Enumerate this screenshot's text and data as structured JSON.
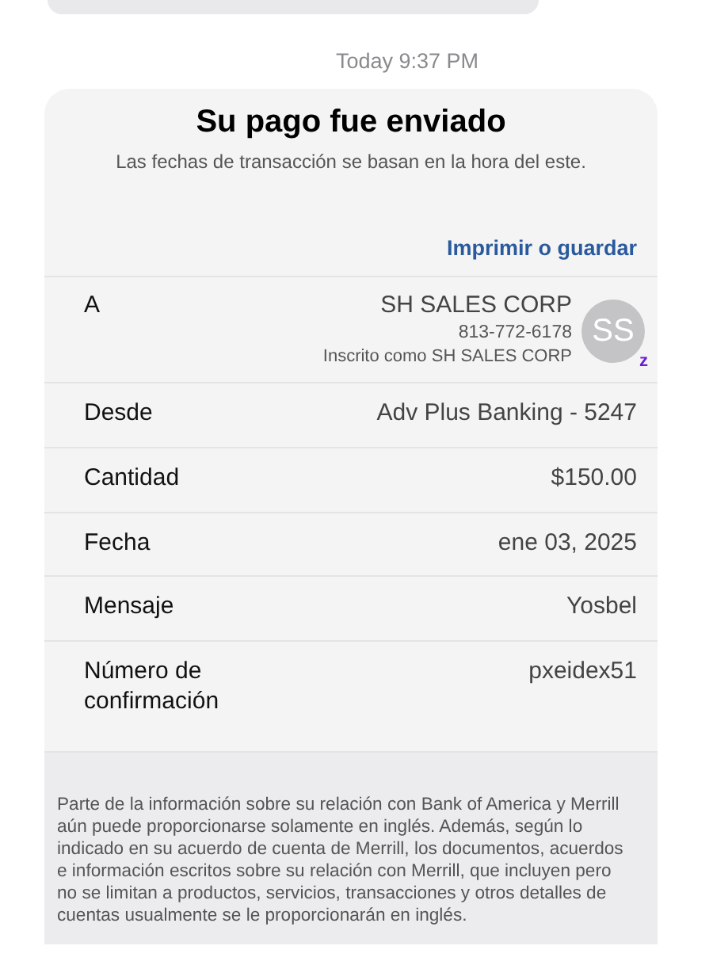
{
  "timestamp": "Today 9:37 PM",
  "card": {
    "title": "Su pago fue enviado",
    "subtitle": "Las fechas de transacción se basan en la hora del este.",
    "print_link": "Imprimir o guardar",
    "recipient": {
      "label": "A",
      "name": "SH SALES CORP",
      "phone": "813-772-6178",
      "enrolled": "Inscrito como SH SALES CORP",
      "avatar_initials": "SS",
      "avatar_badge": "z"
    },
    "rows": [
      {
        "label": "Desde",
        "value": "Adv Plus Banking - 5247"
      },
      {
        "label": "Cantidad",
        "value": "$150.00"
      },
      {
        "label": "Fecha",
        "value": "ene 03, 2025"
      },
      {
        "label": "Mensaje",
        "value": "Yosbel"
      },
      {
        "label": "Número de confirmación",
        "value": "pxeidex51"
      }
    ],
    "disclaimer": "Parte de la información sobre su relación con Bank of America y Merrill aún puede proporcionarse solamente en inglés. Además, según lo indicado en su acuerdo de cuenta de Merrill, los documentos, acuerdos e información escritos sobre su relación con Merrill, que incluyen pero no se limitan a productos, servicios, transacciones y otros detalles de cuentas usualmente se le proporcionarán en inglés."
  }
}
